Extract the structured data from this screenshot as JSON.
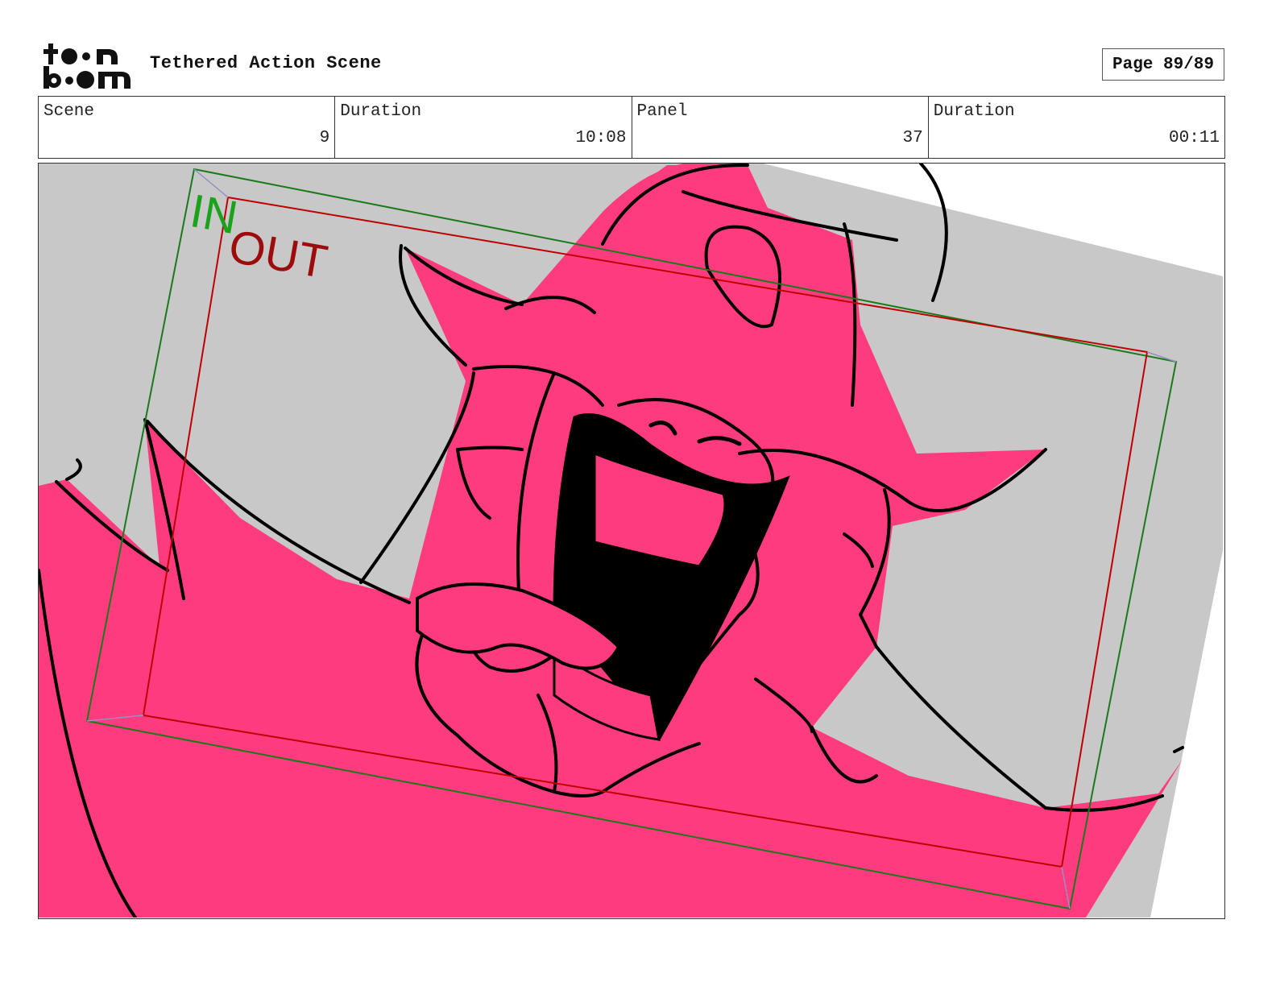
{
  "header": {
    "logo_text": "toonboom",
    "title": "Tethered Action Scene",
    "page_label": "Page 89/89"
  },
  "info": {
    "scene_label": "Scene",
    "scene_value": "9",
    "scene_duration_label": "Duration",
    "scene_duration_value": "10:08",
    "panel_label": "Panel",
    "panel_value": "37",
    "panel_duration_label": "Duration",
    "panel_duration_value": "00:11"
  },
  "panel": {
    "in_label": "IN",
    "out_label": "OUT",
    "colors": {
      "background": "#c8c8c8",
      "character": "#ff3b7f",
      "line": "#000000",
      "in_frame": "#1a7a1a",
      "out_frame": "#c00000"
    }
  }
}
